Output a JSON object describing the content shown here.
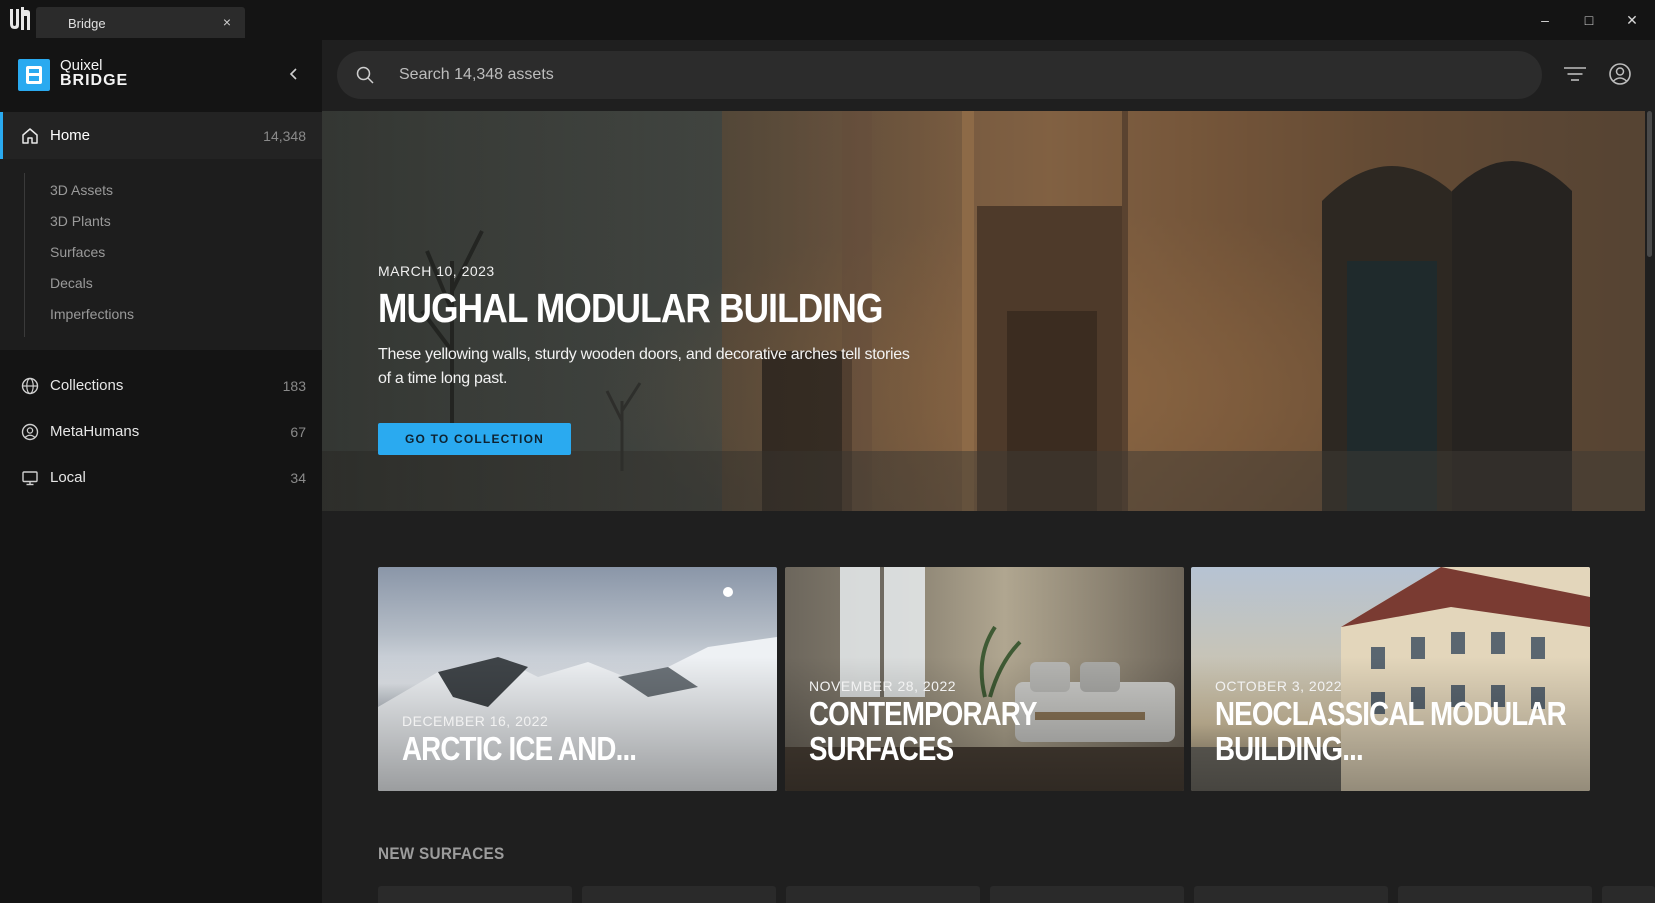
{
  "titlebar": {
    "tab_label": "Bridge",
    "tab_close": "×",
    "minimize": "–",
    "maximize": "□",
    "close": "✕"
  },
  "sidebar": {
    "brand_top": "Quixel",
    "brand_bottom": "BRIDGE",
    "home": {
      "label": "Home",
      "count": "14,348"
    },
    "subnav": [
      "3D Assets",
      "3D Plants",
      "Surfaces",
      "Decals",
      "Imperfections"
    ],
    "items": [
      {
        "label": "Collections",
        "count": "183",
        "icon": "globe-icon"
      },
      {
        "label": "MetaHumans",
        "count": "67",
        "icon": "user-circle-icon"
      },
      {
        "label": "Local",
        "count": "34",
        "icon": "monitor-icon"
      }
    ]
  },
  "search": {
    "placeholder": "Search 14,348 assets"
  },
  "hero": {
    "date": "MARCH 10, 2023",
    "title": "MUGHAL MODULAR BUILDING",
    "description": "These yellowing walls, sturdy wooden doors, and decorative arches tell stories of a time long past.",
    "button_label": "GO TO COLLECTION"
  },
  "cards": [
    {
      "date": "DECEMBER 16, 2022",
      "title_line1": "ARCTIC ICE AND...",
      "title_line2": ""
    },
    {
      "date": "NOVEMBER 28, 2022",
      "title_line1": "CONTEMPORARY",
      "title_line2": "SURFACES"
    },
    {
      "date": "OCTOBER 3, 2022",
      "title_line1": "NEOCLASSICAL MODULAR",
      "title_line2": "BUILDING..."
    }
  ],
  "sections": {
    "new_surfaces": "NEW SURFACES"
  },
  "colors": {
    "accent": "#2aaaf0",
    "sidebar_bg": "#141414",
    "main_bg": "#1f1f1f"
  }
}
